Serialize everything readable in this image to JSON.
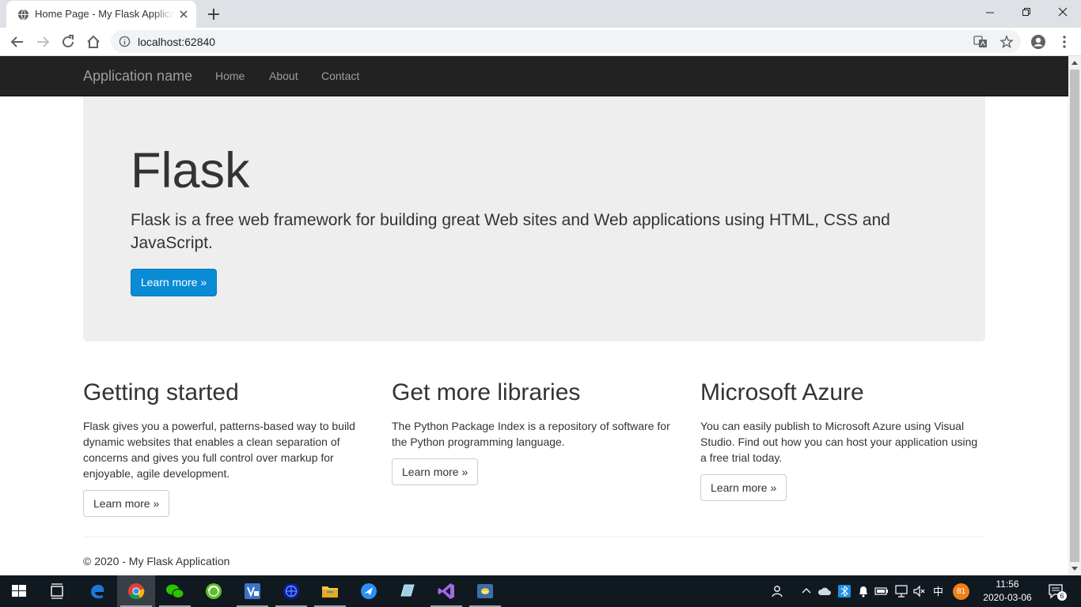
{
  "browser": {
    "tab_title": "Home Page - My Flask Application",
    "url": "localhost:62840"
  },
  "site": {
    "brand": "Application name",
    "nav": [
      {
        "label": "Home"
      },
      {
        "label": "About"
      },
      {
        "label": "Contact"
      }
    ],
    "jumbotron": {
      "heading": "Flask",
      "lead": "Flask is a free web framework for building great Web sites and Web applications using HTML, CSS and JavaScript.",
      "button": "Learn more »"
    },
    "columns": [
      {
        "heading": "Getting started",
        "text": "Flask gives you a powerful, patterns-based way to build dynamic websites that enables a clean separation of concerns and gives you full control over markup for enjoyable, agile development.",
        "button": "Learn more »"
      },
      {
        "heading": "Get more libraries",
        "text": "The Python Package Index is a repository of software for the Python programming language.",
        "button": "Learn more »"
      },
      {
        "heading": "Microsoft Azure",
        "text": "You can easily publish to Microsoft Azure using Visual Studio. Find out how you can host your application using a free trial today.",
        "button": "Learn more »"
      }
    ],
    "footer": "© 2020 - My Flask Application"
  },
  "taskbar": {
    "apps": [
      "start-icon",
      "task-view-icon",
      "edge-icon",
      "chrome-icon",
      "wechat-icon",
      "qihoo-browser-icon",
      "visio-icon",
      "network-app-icon",
      "file-explorer-icon",
      "feishu-icon",
      "pad-app-icon",
      "visual-studio-icon",
      "python-icon"
    ],
    "tray": {
      "ime": "中",
      "badge": "81",
      "time": "11:56",
      "date": "2020-03-06",
      "notification_count": "6"
    }
  },
  "colors": {
    "navbar_bg": "#222222",
    "jumbotron_bg": "#eeeeee",
    "primary_button": "#0a8bd6",
    "taskbar_bg": "#101820"
  }
}
